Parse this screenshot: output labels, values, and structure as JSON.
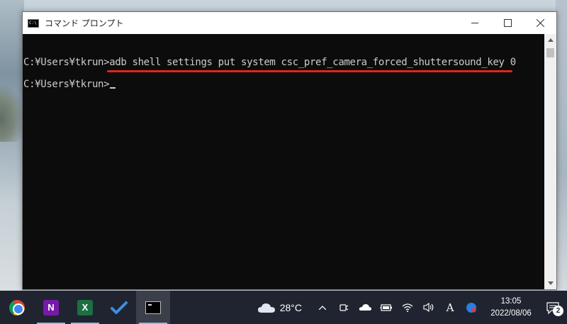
{
  "window": {
    "title": "コマンド プロンプト",
    "controls": {
      "minimize": "minimize",
      "maximize": "maximize",
      "close": "close"
    }
  },
  "console": {
    "prompt1": "C:¥Users¥tkrun>",
    "command1": "adb shell settings put system csc_pref_camera_forced_shuttersound_key 0",
    "prompt2": "C:¥Users¥tkrun>",
    "highlight_color": "#e0261b"
  },
  "taskbar": {
    "apps": [
      {
        "name": "Google Chrome",
        "icon": "chrome-icon"
      },
      {
        "name": "OneNote",
        "icon": "onenote-icon",
        "letter": "N"
      },
      {
        "name": "Excel",
        "icon": "excel-icon",
        "letter": "X"
      },
      {
        "name": "Microsoft To Do",
        "icon": "todo-icon"
      },
      {
        "name": "コマンド プロンプト",
        "icon": "cmd-icon"
      }
    ],
    "weather": {
      "temp": "28°C",
      "icon": "cloud-icon"
    },
    "tray_icons": [
      "chevron-up-icon",
      "meet-now-icon",
      "onedrive-icon",
      "battery-icon",
      "wifi-icon",
      "volume-icon",
      "ime-icon",
      "edge-profile-icon"
    ],
    "ime_label": "A",
    "clock": {
      "time": "13:05",
      "date": "2022/08/06"
    },
    "notifications": {
      "count": "2"
    }
  }
}
